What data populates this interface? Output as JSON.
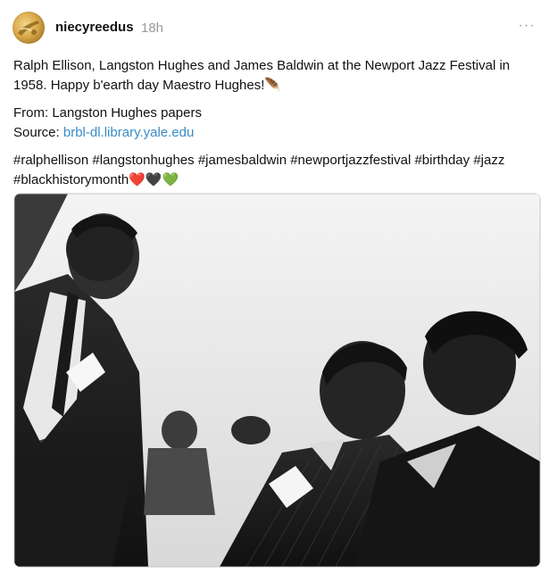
{
  "post": {
    "username": "niecyreedus",
    "timestamp": "18h",
    "more_label": "···",
    "caption": {
      "line1": "Ralph Ellison, Langston Hughes and James Baldwin at the Newport Jazz Festival in 1958. Happy b'earth day Maestro Hughes!🪶",
      "from": "From: Langston Hughes papers",
      "source_label": "Source: ",
      "source_link": "brbl-dl.library.yale.edu",
      "hashtags": "#ralphellison #langstonhughes #jamesbaldwin #newportjazzfestival #birthday #jazz #blackhistorymonth❤️🖤💚"
    },
    "photo_alt": "Black and white photograph of three men at the Newport Jazz Festival"
  },
  "icons": {
    "avatar": "avatar-image",
    "more": "more-options-icon"
  },
  "colors": {
    "link": "#3a8cc4",
    "timestamp": "#9a9a9a",
    "text": "#111111"
  }
}
